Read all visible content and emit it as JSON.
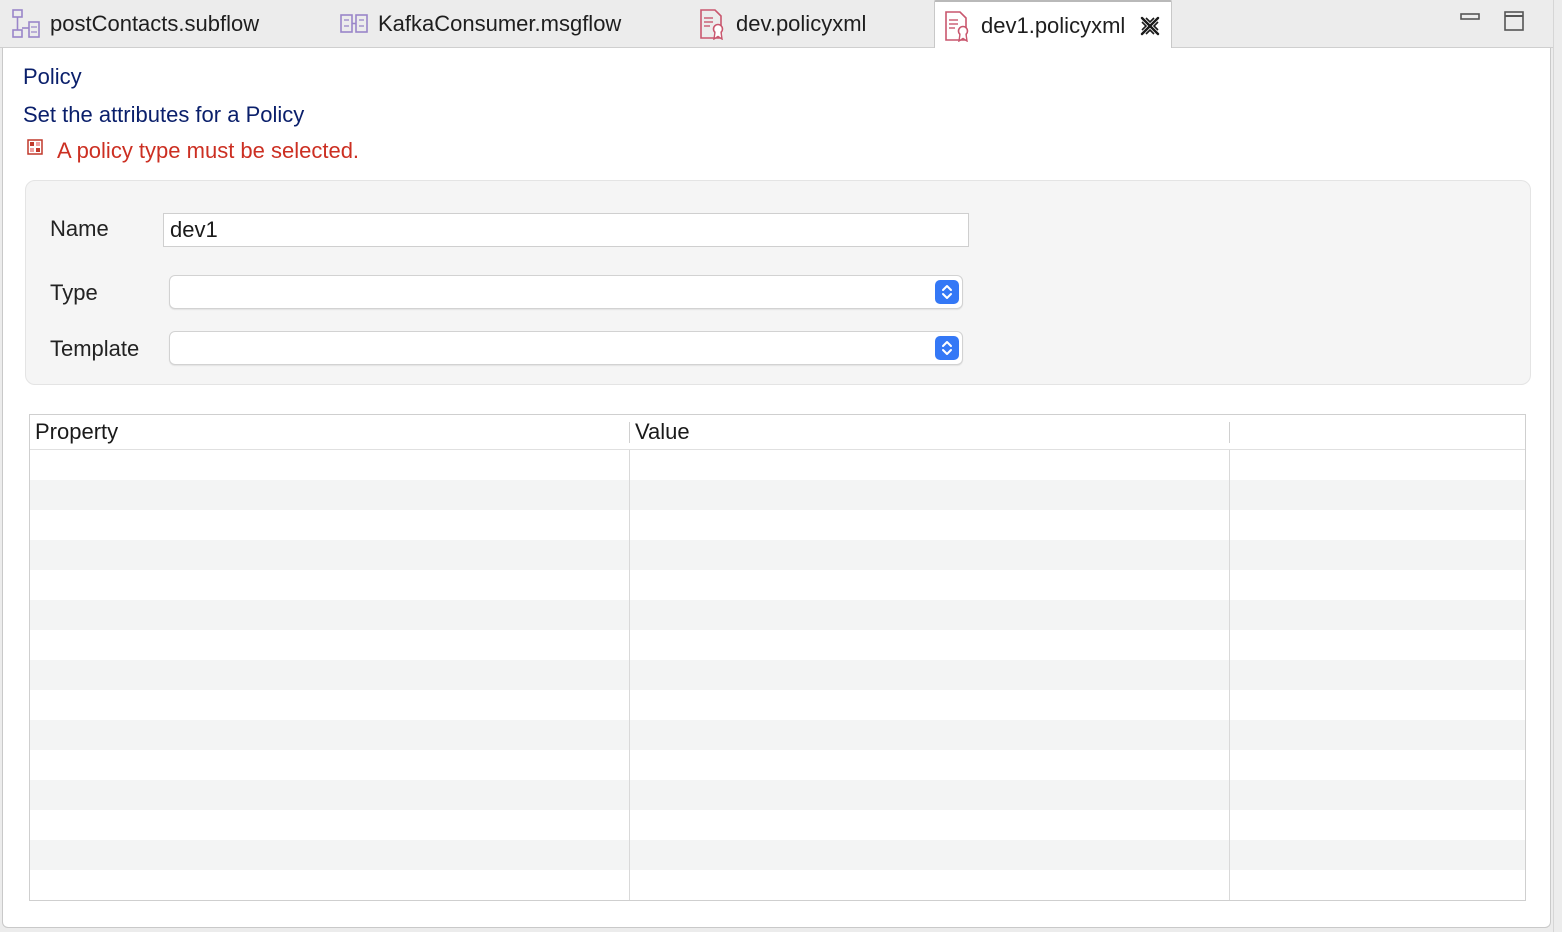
{
  "tabs": [
    {
      "label": "postContacts.subflow",
      "icon": "subflow-icon"
    },
    {
      "label": "KafkaConsumer.msgflow",
      "icon": "msgflow-icon"
    },
    {
      "label": "dev.policyxml",
      "icon": "policy-file-icon"
    },
    {
      "label": "dev1.policyxml",
      "icon": "policy-file-icon",
      "active": true
    }
  ],
  "window_controls": [
    "minimize-icon",
    "maximize-icon"
  ],
  "form": {
    "title": "Policy",
    "description": "Set the attributes for a Policy",
    "error": "A policy type must be selected.",
    "fields": {
      "name_label": "Name",
      "name_value": "dev1",
      "type_label": "Type",
      "type_value": "",
      "template_label": "Template",
      "template_value": ""
    }
  },
  "table": {
    "columns": [
      "Property",
      "Value",
      ""
    ],
    "rows": []
  },
  "colors": {
    "title_blue": "#0a1f6b",
    "error_red": "#cc2f22",
    "stepper_blue": "#3478f6"
  }
}
